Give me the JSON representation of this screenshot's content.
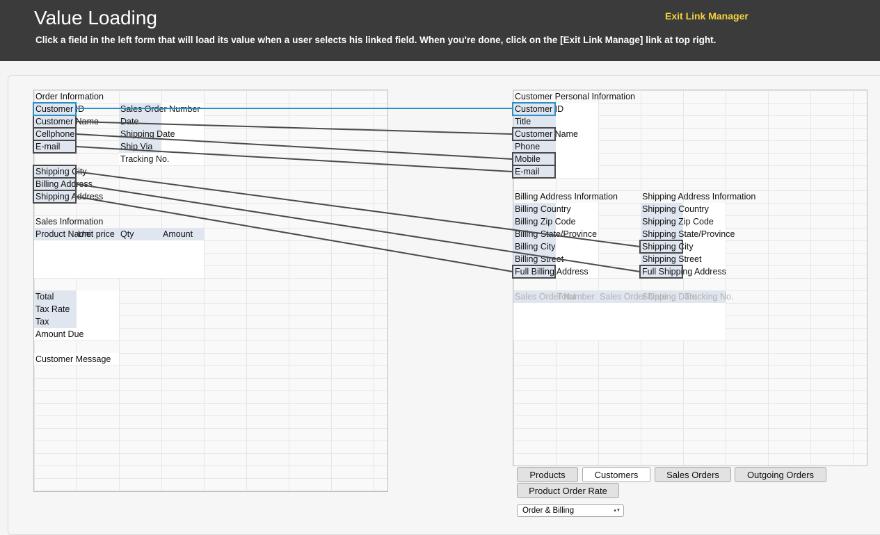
{
  "header": {
    "title": "Value Loading",
    "subtitle": "Click a field in the left form that will load its value when a user selects his linked field. When you're done, click on the [Exit Link Manage] link at top right.",
    "exit_link": "Exit Link Manager"
  },
  "left_form": {
    "order_information": "Order Information",
    "customer_id": "Customer ID",
    "customer_name": "Customer Name",
    "cellphone": "Cellphone",
    "email": "E-mail",
    "sales_order_number": "Sales Order Number",
    "date": "Date",
    "shipping_date": "Shipping Date",
    "ship_via": "Ship Via",
    "tracking_no": "Tracking No.",
    "shipping_city": "Shipping City",
    "billing_address": "Billing Address",
    "shipping_address": "Shipping Address",
    "sales_information": "Sales Information",
    "col_product_name": "Product Name",
    "col_unit_price": "Unit price",
    "col_qty": "Qty",
    "col_amount": "Amount",
    "total": "Total",
    "tax_rate": "Tax Rate",
    "tax": "Tax",
    "amount_due": "Amount Due",
    "customer_message": "Customer Message"
  },
  "right_form": {
    "personal_information": "Customer Personal Information",
    "customer_id": "Customer ID",
    "title": "Title",
    "customer_name": "Customer Name",
    "phone": "Phone",
    "mobile": "Mobile",
    "email": "E-mail",
    "billing_address_information": "Billing Address Information",
    "billing_country": "Billing Country",
    "billing_zip": "Billing Zip Code",
    "billing_state": "Billing State/Province",
    "billing_city": "Billing City",
    "billing_street": "Billing Street",
    "full_billing_address": "Full Billing Address",
    "shipping_address_information": "Shipping Address Information",
    "shipping_country": "Shipping Country",
    "shipping_zip": "Shipping Zip Code",
    "shipping_state": "Shipping State/Province",
    "shipping_city": "Shipping City",
    "shipping_street": "Shipping Street",
    "full_shipping_address": "Full Shipping Address",
    "ghost_headers": [
      "Sales Order Number",
      "Total",
      "Sales Order Date",
      "Shipping Date",
      "Tracking No."
    ]
  },
  "tabs": [
    "Products",
    "Customers",
    "Sales Orders",
    "Outgoing Orders",
    "Product Order Rate"
  ],
  "active_tab": "Customers",
  "view_select": {
    "selected": "Order & Billing"
  },
  "colors": {
    "header_bg": "#3b3b3b",
    "exit_link": "#f5d23c",
    "link_blue": "#2f8fc4",
    "link_gray": "#4a4a4a",
    "label_bg": "#dfe6ef"
  }
}
